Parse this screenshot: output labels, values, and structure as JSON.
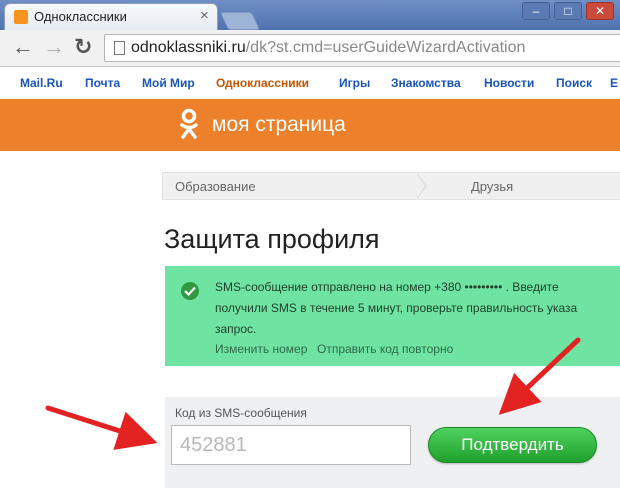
{
  "browser": {
    "tab_title": "Одноклассники",
    "tab_close": "×",
    "win_minimize": "–",
    "win_maximize": "□",
    "win_close": "✕",
    "url_domain": "odnoklassniki.ru",
    "url_path": "/dk?st.cmd=userGuideWizardActivation",
    "back_glyph": "←",
    "forward_glyph": "→",
    "reload_glyph": "↻"
  },
  "portal_bar": {
    "items": [
      {
        "label": "Mail.Ru",
        "active": false
      },
      {
        "label": "Почта",
        "active": false
      },
      {
        "label": "Мой Мир",
        "active": false
      },
      {
        "label": "Одноклассники",
        "active": true
      },
      {
        "label": "Игры",
        "active": false
      },
      {
        "label": "Знакомства",
        "active": false
      },
      {
        "label": "Новости",
        "active": false
      },
      {
        "label": "Поиск",
        "active": false
      },
      {
        "label": "Е",
        "active": false
      }
    ]
  },
  "header": {
    "title": "моя страница",
    "logo_icon": "odnoklassniki-logo-icon"
  },
  "breadcrumb": {
    "step1": "Образование",
    "step2": "Друзья"
  },
  "page": {
    "title": "Защита профиля"
  },
  "notice": {
    "icon": "check-circle-icon",
    "line1": "SMS-сообщение отправлено на номер +380 ••••••••• . Введите",
    "line2": "получили SMS в течение 5 минут, проверьте правильность указа",
    "line3": "запрос.",
    "change_number": "Изменить номер",
    "resend_code": "Отправить код повторно"
  },
  "form": {
    "code_label": "Код из SMS-сообщения",
    "code_value": "452881",
    "confirm_label": "Подтвердить"
  },
  "colors": {
    "ok_orange": "#ed812b",
    "notice_green": "#6fe3a2",
    "button_green": "#1fa02c",
    "annotation_red": "#e32222"
  }
}
